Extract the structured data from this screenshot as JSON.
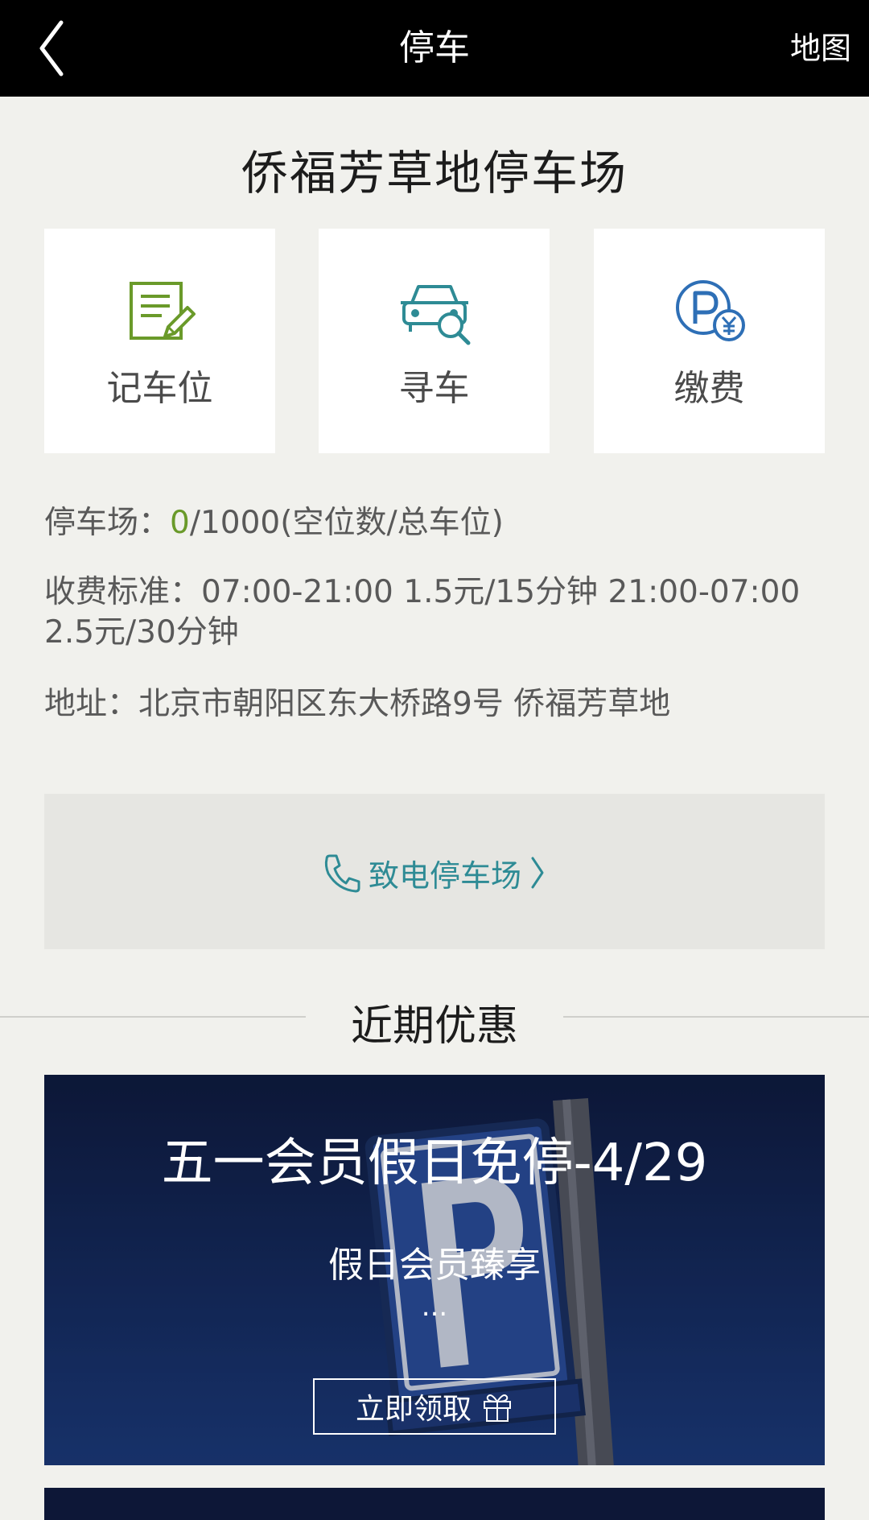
{
  "header": {
    "title": "停车",
    "map_label": "地图"
  },
  "lot": {
    "name": "侨福芳草地停车场"
  },
  "actions": [
    {
      "label": "记车位",
      "icon": "note-edit-icon"
    },
    {
      "label": "寻车",
      "icon": "car-search-icon"
    },
    {
      "label": "缴费",
      "icon": "parking-pay-icon"
    }
  ],
  "info": {
    "capacity_label": "停车场：",
    "capacity_free": "0",
    "capacity_rest": "/1000(空位数/总车位)",
    "fee_label": "收费标准：",
    "fee_value": "07:00-21:00 1.5元/15分钟 21:00-07:00 2.5元/30分钟",
    "address_label": "地址：",
    "address_value": "北京市朝阳区东大桥路9号 侨福芳草地"
  },
  "call": {
    "label": "致电停车场"
  },
  "promotions": {
    "section_title": "近期优惠",
    "items": [
      {
        "title": "五一会员假日免停-4/29",
        "subtitle": "假日会员臻享",
        "more": "...",
        "button": "立即领取"
      }
    ]
  },
  "colors": {
    "accent_teal": "#2e8b95",
    "accent_green": "#6a9a2a",
    "header_bg": "#000000"
  }
}
